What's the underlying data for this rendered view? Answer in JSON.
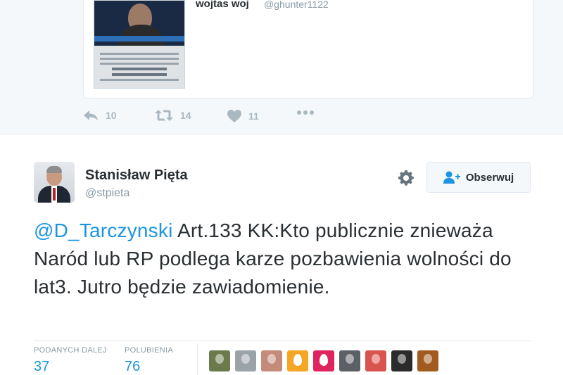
{
  "quoted_tweet": {
    "name": "wojtas woj",
    "handle": "@ghunter1122",
    "actions": {
      "reply_count": "10",
      "retweet_count": "14",
      "like_count": "11"
    }
  },
  "tweet": {
    "author_name": "Stanisław Pięta",
    "author_handle": "@stpieta",
    "follow_label": "Obserwuj",
    "mention": "@D_Tarczynski",
    "body_text": " Art.133 KK:Kto publicznie znieważa Naród lub RP podlega karze pozbawienia wolności do lat3. Jutro będzie zawiadomienie.",
    "stats": {
      "retweets_label": "PODANYCH DALEJ",
      "retweets_value": "37",
      "likes_label": "POLUBIENIA",
      "likes_value": "76"
    },
    "liker_avatars": [
      {
        "color": "#6b7a4a"
      },
      {
        "color": "#9aa3a8"
      },
      {
        "color": "#c48a7a"
      },
      {
        "color": "#f5a623",
        "egg": true
      },
      {
        "color": "#e0245e",
        "egg": true
      },
      {
        "color": "#5b5f66"
      },
      {
        "color": "#d9534f"
      },
      {
        "color": "#2b2b2b"
      },
      {
        "color": "#a35a1f"
      }
    ]
  },
  "colors": {
    "link": "#1b95e0",
    "muted": "#8899a6",
    "icon": "#aab8c2"
  }
}
